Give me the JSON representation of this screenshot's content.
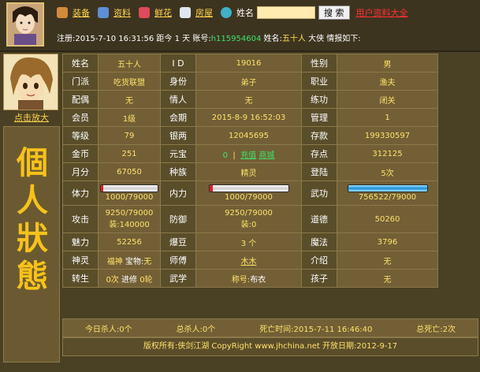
{
  "header": {
    "nav": [
      {
        "label": "装备",
        "icon": "equipment-icon"
      },
      {
        "label": "资料",
        "icon": "profile-icon"
      },
      {
        "label": "鲜花",
        "icon": "flower-icon"
      },
      {
        "label": "房屋",
        "icon": "house-icon"
      }
    ],
    "name_label": "姓名",
    "search_value": "",
    "search_button": "搜 索",
    "all_users_link": "用户资料大全",
    "status": {
      "register_prefix": "注册:",
      "register_time": "2015-7-10 16:31:56",
      "since_prefix": "距今",
      "days": "1",
      "days_unit": "天",
      "account_prefix": "账号:",
      "account": "h115954604",
      "name_prefix": "姓名:",
      "name": "五十人",
      "suffix": "大侠 情报如下:"
    }
  },
  "left": {
    "enlarge_link": "点击放大",
    "title_chars": [
      "個",
      "人",
      "狀",
      "態"
    ]
  },
  "table": {
    "rows": [
      [
        {
          "l": "姓名",
          "v": "五十人"
        },
        {
          "l": "I D",
          "v": "19016"
        },
        {
          "l": "性别",
          "v": "男"
        }
      ],
      [
        {
          "l": "门派",
          "v": "吃货联盟"
        },
        {
          "l": "身份",
          "v": "弟子"
        },
        {
          "l": "职业",
          "v": "渔夫"
        }
      ],
      [
        {
          "l": "配偶",
          "v": "无"
        },
        {
          "l": "情人",
          "v": "无"
        },
        {
          "l": "练功",
          "v": "闭关"
        }
      ],
      [
        {
          "l": "会员",
          "v": "1级"
        },
        {
          "l": "会期",
          "v": "2015-8-9 16:52:03"
        },
        {
          "l": "管理",
          "v": "1"
        }
      ],
      [
        {
          "l": "等级",
          "v": "79"
        },
        {
          "l": "银两",
          "v": "12045695"
        },
        {
          "l": "存款",
          "v": "199330597"
        }
      ],
      [
        {
          "l": "金币",
          "v": "251"
        },
        {
          "l": "元宝",
          "v": "0"
        },
        {
          "l": "存点",
          "v": "312125"
        }
      ],
      [
        {
          "l": "月分",
          "v": "67050"
        },
        {
          "l": "种族",
          "v": "精灵"
        },
        {
          "l": "登陆",
          "v": "5次"
        }
      ]
    ],
    "yuanbao_links": {
      "recharge": "充值",
      "shop": "商城"
    },
    "vitals": {
      "hp_label": "体力",
      "hp_text": "1000/79000",
      "hp_fraction": 0.0127,
      "mp_label": "内力",
      "mp_text": "1000/79000",
      "mp_fraction": 0.0127,
      "atk_label": "武功",
      "atk_text": "756522/79000",
      "atk_fraction": 1.0
    },
    "attack": {
      "label": "攻击",
      "line1": "9250/79000",
      "line2": "装:140000"
    },
    "defense": {
      "label": "防御",
      "line1": "9250/79000",
      "line2": "装:0"
    },
    "morality": {
      "label": "道德",
      "value": "50260"
    },
    "rows2": [
      [
        {
          "l": "魅力",
          "v": "52256"
        },
        {
          "l": "爆豆",
          "v": "3 个"
        },
        {
          "l": "魔法",
          "v": "3796"
        }
      ]
    ],
    "spirit": {
      "label": "神灵",
      "pet_name": "福神",
      "treasure_label": "宝物:",
      "treasure_value": "无"
    },
    "master": {
      "label": "师傅",
      "value": "木木"
    },
    "intro": {
      "label": "介绍",
      "value": "无"
    },
    "rebirth": {
      "label": "转生",
      "value": "0次",
      "advance_label": "进修",
      "advance_value": "0轮"
    },
    "skill": {
      "label": "武学",
      "title_label": "称号:",
      "title_value": "布衣"
    },
    "children": {
      "label": "孩子",
      "value": "无"
    }
  },
  "footer": {
    "kills_today": "今日杀人:0个",
    "kills_total": "总杀人:0个",
    "death_time": "死亡时间:2015-7-11 16:46:40",
    "deaths_total": "总死亡:2次",
    "copyright": "版权所有:侠剑江湖 CopyRight www.jhchina.net  开放日期:2012-9-17"
  }
}
